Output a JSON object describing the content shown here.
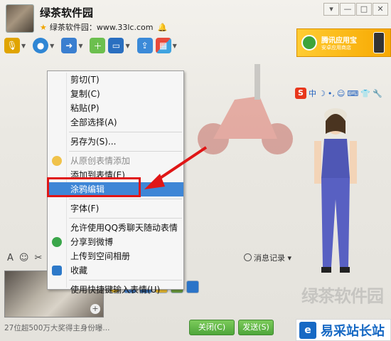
{
  "window": {
    "title": "绿茶软件园",
    "subtitle": "绿茶软件园：www.33lc.com",
    "buttons": [
      "▾",
      "—",
      "□",
      "✕"
    ]
  },
  "toolbar": {
    "items": [
      "microphone-icon",
      "video-camera-icon",
      "file-transfer-icon",
      "add-member-icon",
      "remote-desktop-icon",
      "share-screen-icon",
      "apps-grid-icon"
    ]
  },
  "app_banner": {
    "title": "腾讯应用宝",
    "tagline": "安卓应用商店"
  },
  "ime_toolbar": {
    "logo": "S",
    "mode": "中"
  },
  "context_menu": {
    "items": [
      {
        "label": "剪切(T)",
        "type": "item"
      },
      {
        "label": "复制(C)",
        "type": "item"
      },
      {
        "label": "粘贴(P)",
        "type": "item"
      },
      {
        "label": "全部选择(A)",
        "type": "item"
      },
      {
        "type": "separator"
      },
      {
        "label": "另存为(S)...",
        "type": "item"
      },
      {
        "type": "separator"
      },
      {
        "label": "从原创表情添加",
        "type": "disabled",
        "icon": "emoticon-icon"
      },
      {
        "label": "添加到表情(E)",
        "type": "item"
      },
      {
        "label": "涂鸦编辑",
        "type": "selected"
      },
      {
        "type": "separator"
      },
      {
        "label": "字体(F)",
        "type": "item"
      },
      {
        "type": "separator"
      },
      {
        "label": "允许使用QQ秀聊天随动表情",
        "type": "item"
      },
      {
        "label": "分享到微博",
        "type": "item",
        "icon": "weibo-icon"
      },
      {
        "label": "上传到空间相册",
        "type": "item"
      },
      {
        "label": "收藏",
        "type": "item",
        "icon": "favorite-icon"
      },
      {
        "type": "separator"
      },
      {
        "label": "使用快捷键输入表情(U)",
        "type": "item"
      }
    ]
  },
  "format_bar": {
    "font_icon": "A",
    "history_label": "消息记录"
  },
  "status_bar": {
    "text": "27位超500万大奖得主身份曝...",
    "close_label": "关闭(C)",
    "send_label": "发送(S)"
  },
  "watermark": {
    "line1": "绿茶软件园",
    "line2": "易采站长站"
  },
  "colors": {
    "menu_selected": "#3e86d6",
    "highlight_box": "#e01616",
    "button_green": "#4ea63a"
  }
}
